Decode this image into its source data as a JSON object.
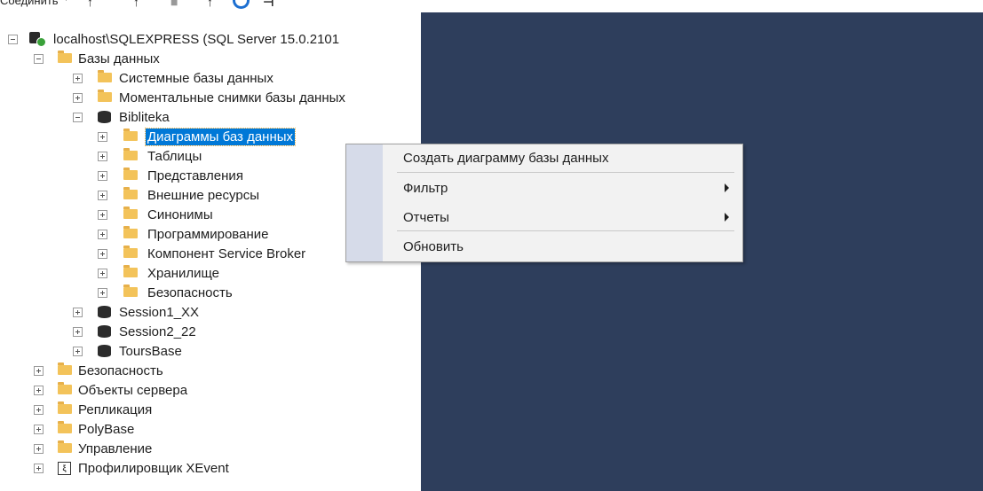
{
  "toolbar": {
    "connect_label": "Соединить",
    "connect_caret": "▾",
    "icon_names": [
      "connect-filter-icon",
      "disconnect-icon",
      "stop-icon",
      "filter-icon",
      "refresh-icon",
      "activity-icon"
    ]
  },
  "tree": {
    "server": "localhost\\SQLEXPRESS (SQL Server 15.0.2101",
    "databases_folder": "Базы данных",
    "system_databases": "Системные базы данных",
    "snapshots": "Моментальные снимки базы данных",
    "bibliteka": {
      "name": "Bibliteka",
      "children": {
        "diagrams": "Диаграммы баз данных",
        "tables": "Таблицы",
        "views": "Представления",
        "external": "Внешние ресурсы",
        "synonyms": "Синонимы",
        "programmability": "Программирование",
        "service_broker": "Компонент Service Broker",
        "storage": "Хранилище",
        "security": "Безопасность"
      }
    },
    "session1": "Session1_XX",
    "session2": "Session2_22",
    "toursbase": "ToursBase",
    "server_security": "Безопасность",
    "server_objects": "Объекты сервера",
    "replication": "Репликация",
    "polybase": "PolyBase",
    "management": "Управление",
    "xevent_profiler": "Профилировщик XEvent"
  },
  "context_menu": {
    "create_diagram": "Создать диаграмму базы данных",
    "filter": "Фильтр",
    "reports": "Отчеты",
    "refresh": "Обновить"
  },
  "colors": {
    "selection": "#0078d7",
    "background_panel": "#2e3e5c",
    "menu_gutter": "#d6dbe9",
    "folder": "#f3c35a"
  }
}
